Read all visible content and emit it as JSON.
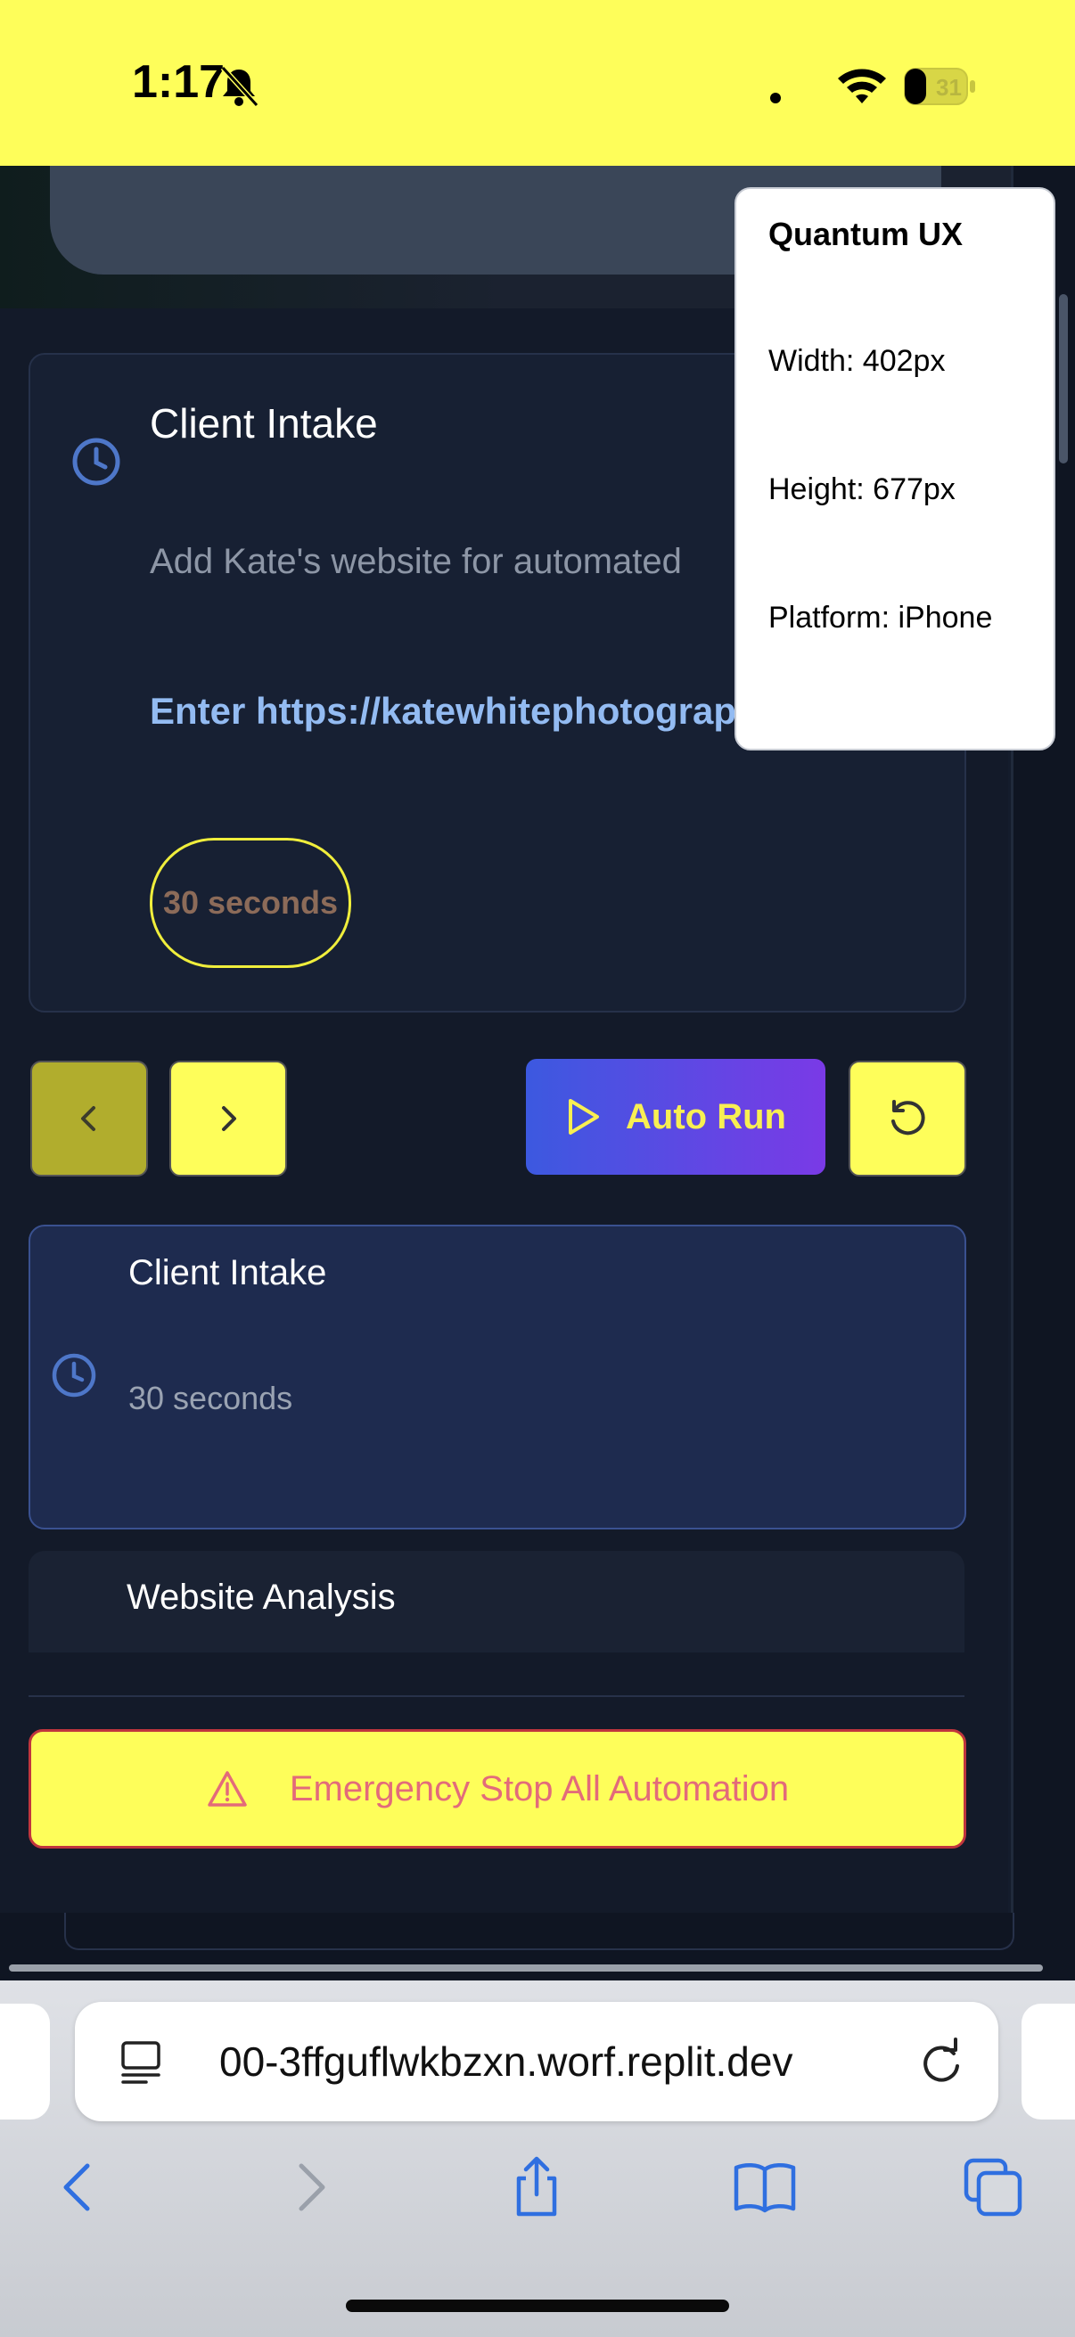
{
  "status_bar": {
    "time": "1:17",
    "battery": "31"
  },
  "current_step": {
    "title": "Client Intake",
    "description": "Add Kate's website for automated",
    "instruction": "Enter https://katewhitephotograp",
    "duration": "30 seconds"
  },
  "controls": {
    "auto_run_label": "Auto Run"
  },
  "steps": [
    {
      "title": "Client Intake",
      "duration": "30 seconds"
    },
    {
      "title": "Website Analysis"
    }
  ],
  "emergency": {
    "label": "Emergency Stop All Automation"
  },
  "popup": {
    "title": "Quantum UX",
    "width": "Width: 402px",
    "height": "Height: 677px",
    "platform": "Platform: iPhone"
  },
  "browser": {
    "url": "00-3ffguflwkbzxn.worf.replit.dev"
  },
  "colors": {
    "status_bar_bg": "#fefe5a",
    "accent_yellow": "#fefe5a",
    "auto_run_gradient_start": "#3c59e0",
    "auto_run_gradient_end": "#7a3ae6",
    "emergency_border": "#c0353d",
    "active_step_bg": "#1e2b4f",
    "link_blue": "#93bbf2"
  }
}
